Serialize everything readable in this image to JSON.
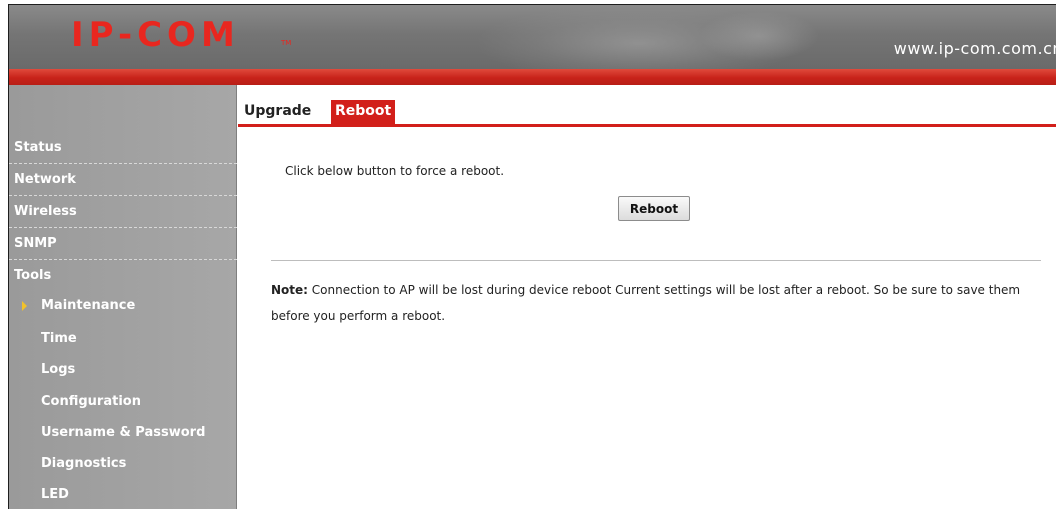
{
  "header": {
    "logo_text": "IP-COM",
    "logo_tm": "TM",
    "site_url": "www.ip-com.com.cn"
  },
  "sidebar": {
    "items": [
      {
        "label": "Status"
      },
      {
        "label": "Network"
      },
      {
        "label": "Wireless"
      },
      {
        "label": "SNMP"
      },
      {
        "label": "Tools"
      },
      {
        "label": "Maintenance",
        "active": true
      },
      {
        "label": "Time"
      },
      {
        "label": "Logs"
      },
      {
        "label": "Configuration"
      },
      {
        "label": "Username & Password"
      },
      {
        "label": "Diagnostics"
      },
      {
        "label": "LED"
      }
    ]
  },
  "tabs": [
    {
      "label": "Upgrade",
      "active": false
    },
    {
      "label": "Reboot",
      "active": true
    }
  ],
  "main": {
    "message": "Click below button to force a reboot.",
    "reboot_button": "Reboot",
    "note_label": "Note:",
    "note_text": "Connection to AP will be lost during device reboot Current settings will be lost after a reboot. So be sure to save them before you perform a reboot."
  },
  "colors": {
    "accent_red": "#d21f1a",
    "header_gray": "#777777",
    "sidebar_gray": "#a0a0a0",
    "active_arrow": "#f2c22a"
  }
}
